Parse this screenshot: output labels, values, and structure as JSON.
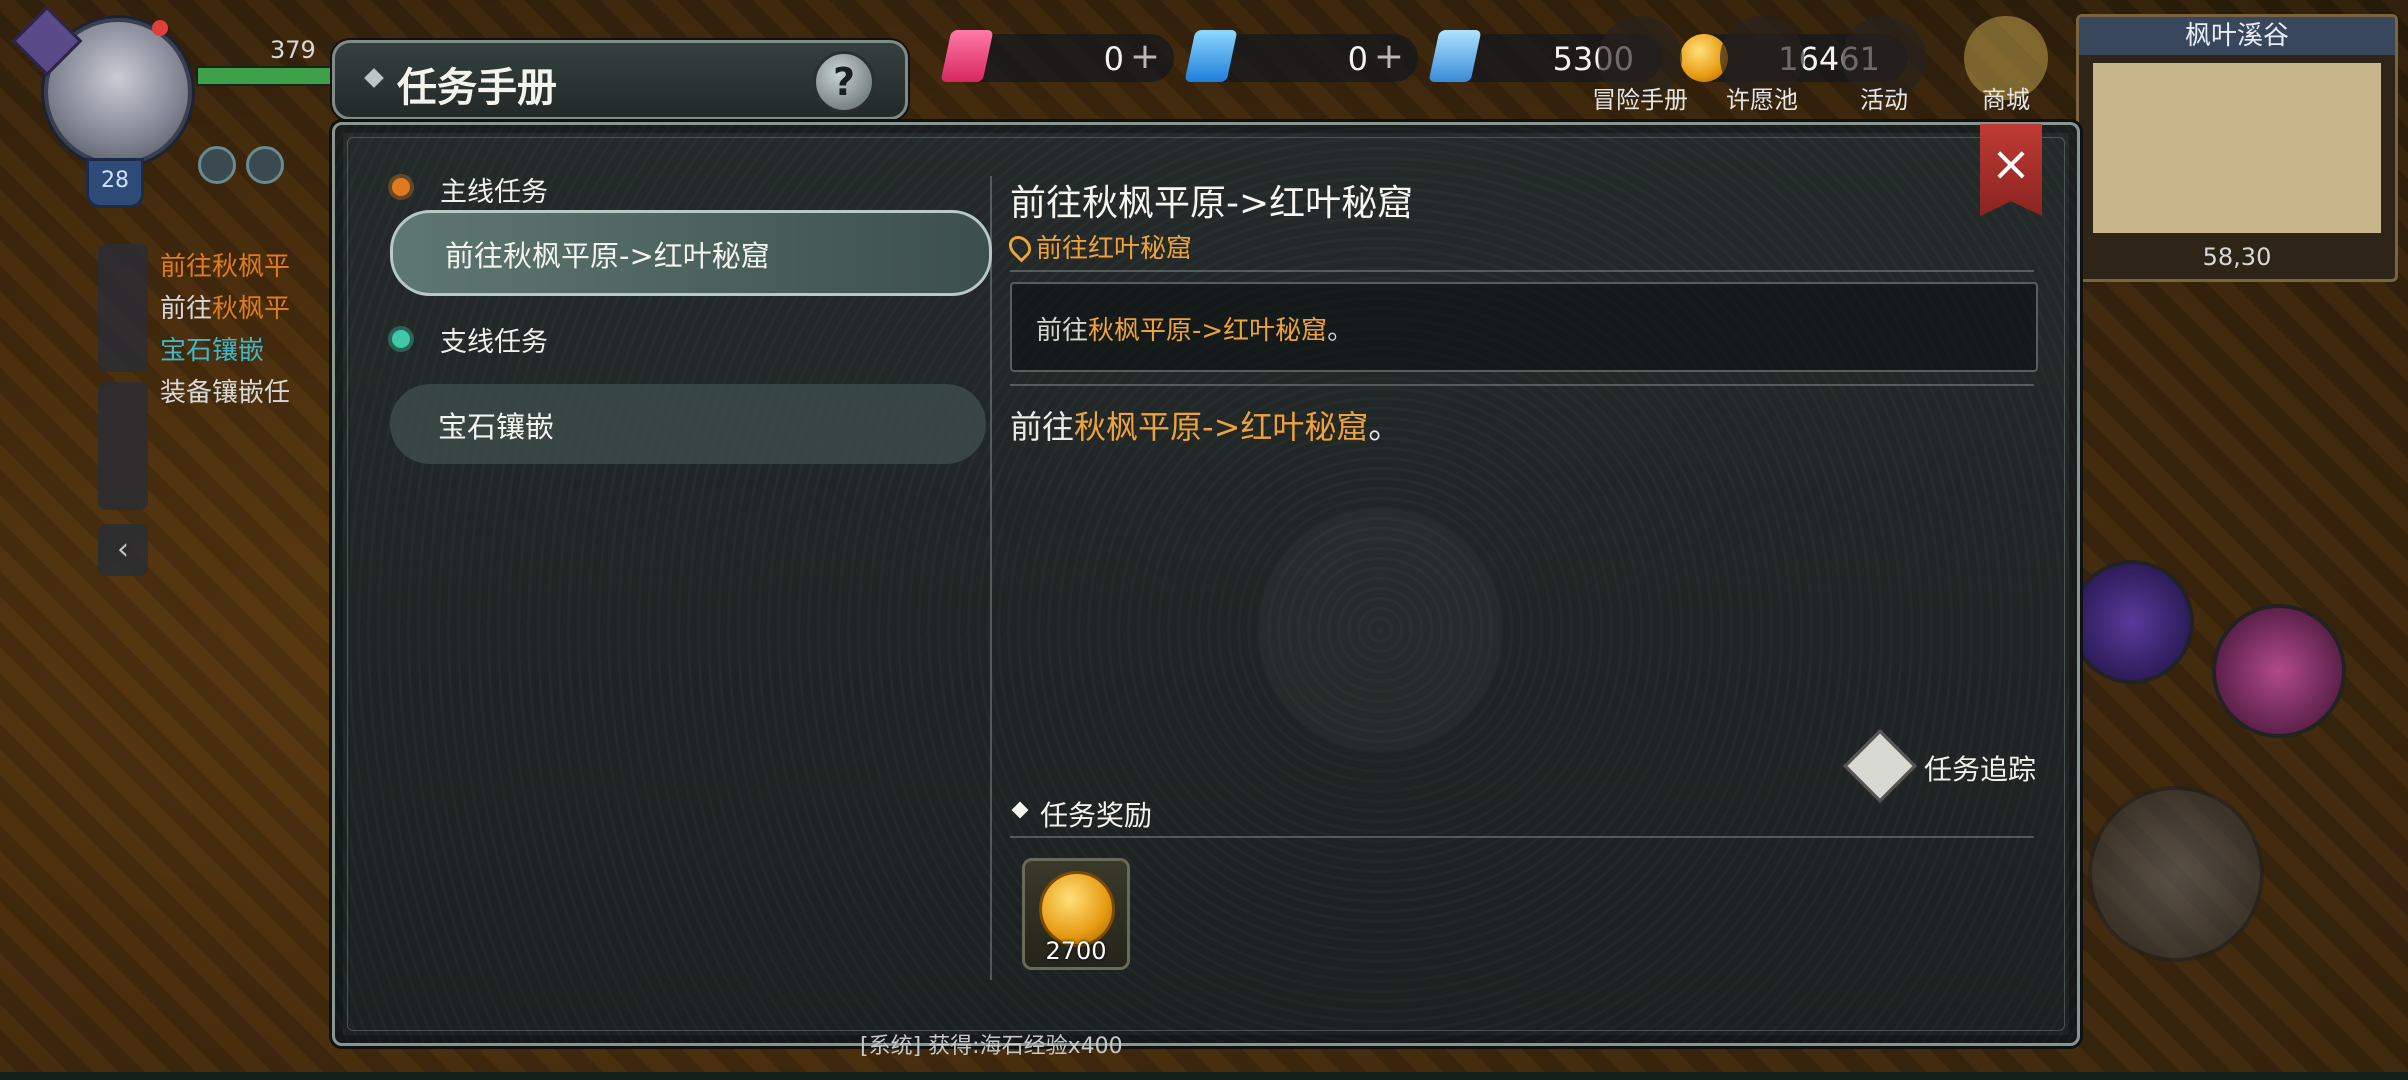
{
  "hud": {
    "hp_value": "379",
    "level": "28"
  },
  "tracker": {
    "main_title": "前往秋枫平",
    "main_sub_prefix": "前往",
    "main_sub_highlight": "秋枫平",
    "side_title": "宝石镶嵌",
    "side_sub": "装备镶嵌任"
  },
  "panel": {
    "title": "任务手册",
    "help": "?",
    "close": "×"
  },
  "currency": {
    "red_crystal": "0",
    "blue_crystal": "0",
    "locked_crystal": "5300",
    "gold": "16461",
    "plus": "+"
  },
  "top_menu": [
    {
      "label": "冒险手册"
    },
    {
      "label": "许愿池"
    },
    {
      "label": "活动"
    },
    {
      "label": "商城"
    }
  ],
  "minimap": {
    "name": "枫叶溪谷",
    "coords": "58,30"
  },
  "categories": {
    "main": "主线任务",
    "side": "支线任务"
  },
  "quests": {
    "main_item": "前往秋枫平原->红叶秘窟",
    "side_item": "宝石镶嵌"
  },
  "detail": {
    "title": "前往秋枫平原->红叶秘窟",
    "location": "前往红叶秘窟",
    "box_prefix": "前往",
    "box_highlight": "秋枫平原->红叶秘窟",
    "box_suffix": "。",
    "desc_prefix": "前往",
    "desc_highlight": "秋枫平原->红叶秘窟",
    "desc_suffix": "。",
    "track_label": "任务追踪",
    "reward_title": "任务奖励",
    "reward_amount": "2700"
  },
  "bottom_message": "[系统] 获得:海石经验x400"
}
